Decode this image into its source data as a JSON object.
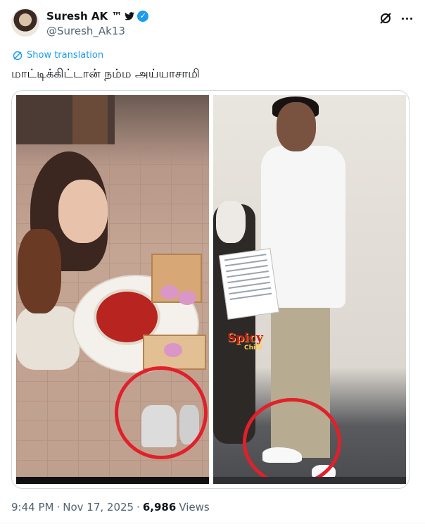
{
  "author": {
    "display_name": "Suresh AK ™",
    "handle": "@Suresh_Ak13",
    "verified": true,
    "badge_icon": "twitter-bird-icon"
  },
  "header_actions": {
    "grok_icon": "grok-icon",
    "more_icon": "more-dots-icon"
  },
  "translation": {
    "label": "Show translation"
  },
  "tweet": {
    "text": "மாட்டிக்கிட்டான் நம்ம அய்யாசாமி"
  },
  "media": {
    "watermark_main": "Spicy",
    "watermark_sub": "Chilli"
  },
  "meta": {
    "time": "9:44 PM",
    "separator1": "·",
    "date": "Nov 17, 2025",
    "separator2": "·",
    "views_count": "6,986",
    "views_label": "Views"
  },
  "colors": {
    "accent": "#1d9bf0",
    "circle": "#e0202a",
    "text_secondary": "#536471"
  }
}
